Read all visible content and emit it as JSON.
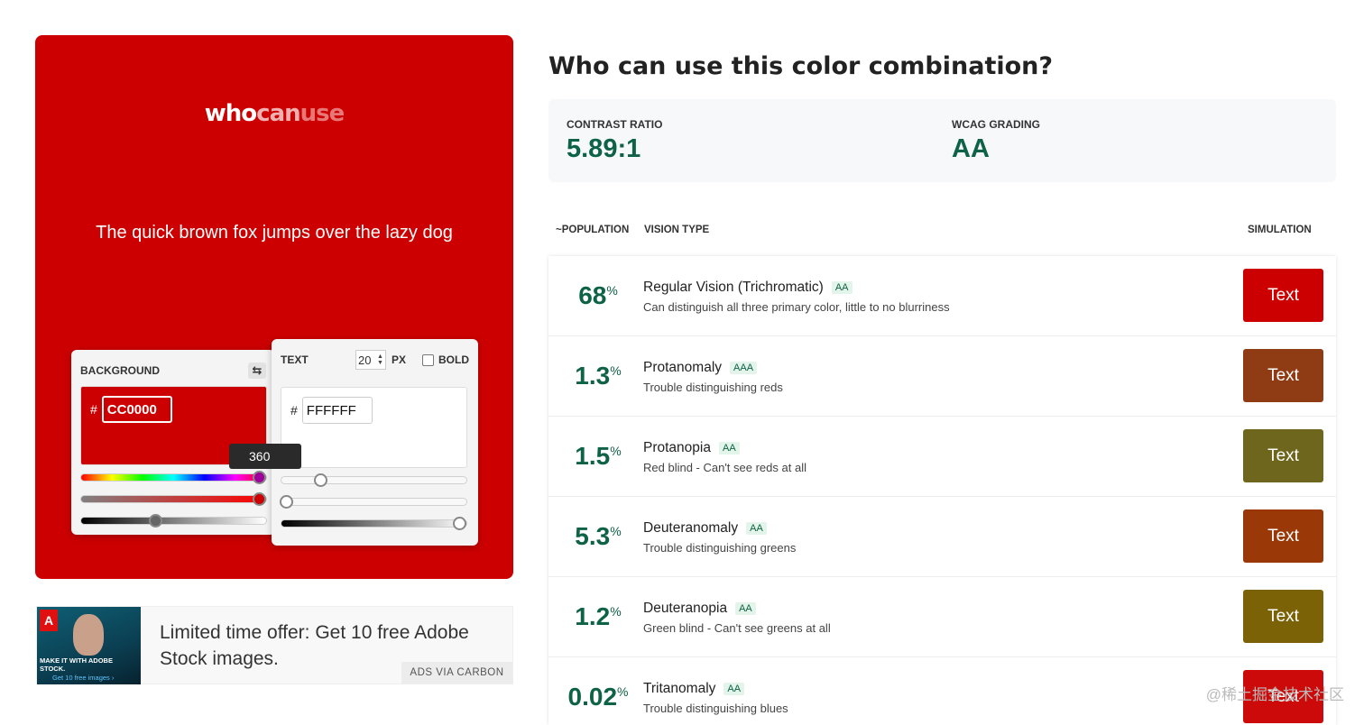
{
  "logo": {
    "who": "who",
    "can": "can",
    "use": "use"
  },
  "preview": {
    "sample_text": "The quick brown fox jumps over the lazy dog"
  },
  "background_picker": {
    "label": "BACKGROUND",
    "swap_icon": "swap-icon",
    "hash": "#",
    "hex_value": "CC0000",
    "hue_tooltip": "360",
    "hue": 360,
    "saturation": 1.0,
    "lightness": 0.4
  },
  "text_picker": {
    "label": "TEXT",
    "size_value": "20",
    "size_unit": "PX",
    "bold_label": "BOLD",
    "hash": "#",
    "hex_value": "FFFFFF",
    "hue": 0.2,
    "saturation": 0.0,
    "lightness": 1.0
  },
  "ad": {
    "caption": "MAKE IT WITH ADOBE STOCK.",
    "sub": "Get 10 free images ›",
    "logo_letter": "A",
    "text": "Limited time offer: Get 10 free Adobe Stock images.",
    "via": "ADS VIA CARBON"
  },
  "title": "Who can use this color combination?",
  "stats": {
    "contrast_label": "CONTRAST RATIO",
    "contrast_value": "5.89:1",
    "wcag_label": "WCAG GRADING",
    "wcag_value": "AA"
  },
  "table_headers": {
    "population": "~POPULATION",
    "vision": "VISION TYPE",
    "simulation": "SIMULATION"
  },
  "rows": [
    {
      "pop": "68",
      "name": "Regular Vision (Trichromatic)",
      "grade": "AA",
      "desc": "Can distinguish all three primary color, little to no blurriness",
      "sim_text": "Text",
      "sim_color": "#cc0000"
    },
    {
      "pop": "1.3",
      "name": "Protanomaly",
      "grade": "AAA",
      "desc": "Trouble distinguishing reds",
      "sim_text": "Text",
      "sim_color": "#8f3c14"
    },
    {
      "pop": "1.5",
      "name": "Protanopia",
      "grade": "AA",
      "desc": "Red blind - Can't see reds at all",
      "sim_text": "Text",
      "sim_color": "#6e661c"
    },
    {
      "pop": "5.3",
      "name": "Deuteranomaly",
      "grade": "AA",
      "desc": "Trouble distinguishing greens",
      "sim_text": "Text",
      "sim_color": "#9a3808"
    },
    {
      "pop": "1.2",
      "name": "Deuteranopia",
      "grade": "AA",
      "desc": "Green blind - Can't see greens at all",
      "sim_text": "Text",
      "sim_color": "#7c6207"
    },
    {
      "pop": "0.02",
      "name": "Tritanomaly",
      "grade": "AA",
      "desc": "Trouble distinguishing blues",
      "sim_text": "Text",
      "sim_color": "#cc0a0a"
    }
  ],
  "percent_sign": "%",
  "watermark": "@稀土掘金技术社区"
}
